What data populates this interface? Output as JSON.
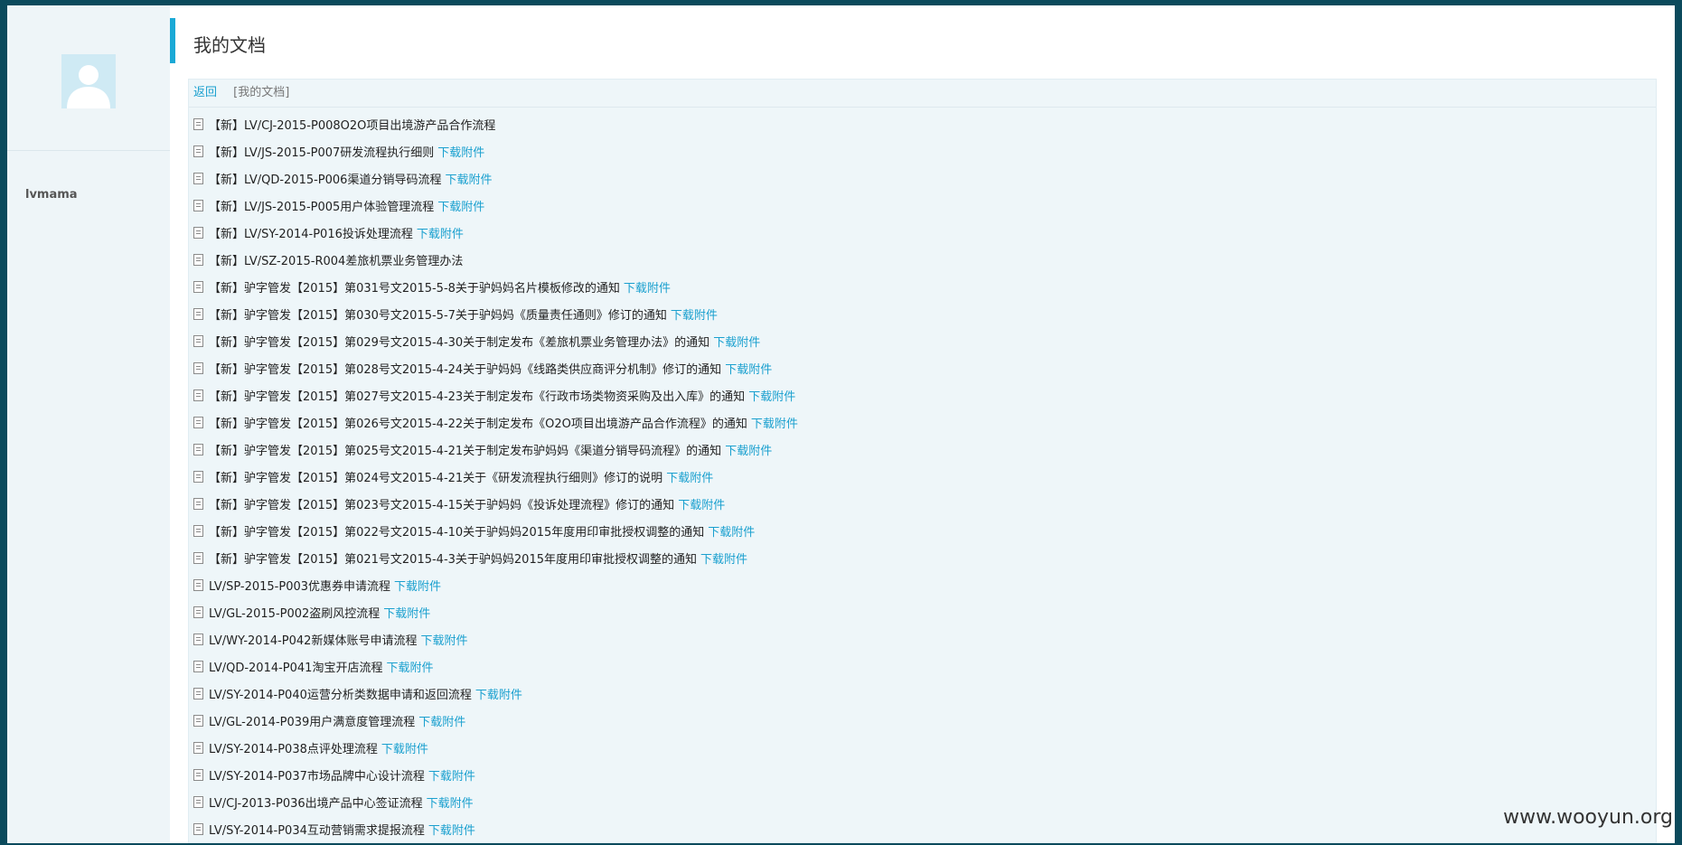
{
  "page": {
    "title": "我的文档",
    "watermark": "www.wooyun.org"
  },
  "sidebar": {
    "username": "lvmama"
  },
  "breadcrumb": {
    "back": "返回",
    "current": "[我的文档]"
  },
  "documents": [
    {
      "title": "【新】LV/CJ-2015-P008O2O项目出境游产品合作流程",
      "link": ""
    },
    {
      "title": "【新】LV/JS-2015-P007研发流程执行细则",
      "link": "下载附件"
    },
    {
      "title": "【新】LV/QD-2015-P006渠道分销导码流程",
      "link": "下载附件"
    },
    {
      "title": "【新】LV/JS-2015-P005用户体验管理流程",
      "link": "下载附件"
    },
    {
      "title": "【新】LV/SY-2014-P016投诉处理流程",
      "link": "下载附件"
    },
    {
      "title": "【新】LV/SZ-2015-R004差旅机票业务管理办法",
      "link": ""
    },
    {
      "title": "【新】驴字管发【2015】第031号文2015-5-8关于驴妈妈名片模板修改的通知",
      "link": "下载附件"
    },
    {
      "title": "【新】驴字管发【2015】第030号文2015-5-7关于驴妈妈《质量责任通则》修订的通知",
      "link": "下载附件"
    },
    {
      "title": "【新】驴字管发【2015】第029号文2015-4-30关于制定发布《差旅机票业务管理办法》的通知",
      "link": "下载附件"
    },
    {
      "title": "【新】驴字管发【2015】第028号文2015-4-24关于驴妈妈《线路类供应商评分机制》修订的通知",
      "link": "下载附件"
    },
    {
      "title": "【新】驴字管发【2015】第027号文2015-4-23关于制定发布《行政市场类物资采购及出入库》的通知",
      "link": "下载附件"
    },
    {
      "title": "【新】驴字管发【2015】第026号文2015-4-22关于制定发布《O2O项目出境游产品合作流程》的通知",
      "link": "下载附件"
    },
    {
      "title": "【新】驴字管发【2015】第025号文2015-4-21关于制定发布驴妈妈《渠道分销导码流程》的通知",
      "link": "下载附件"
    },
    {
      "title": "【新】驴字管发【2015】第024号文2015-4-21关于《研发流程执行细则》修订的说明",
      "link": "下载附件"
    },
    {
      "title": "【新】驴字管发【2015】第023号文2015-4-15关于驴妈妈《投诉处理流程》修订的通知",
      "link": "下载附件"
    },
    {
      "title": "【新】驴字管发【2015】第022号文2015-4-10关于驴妈妈2015年度用印审批授权调整的通知",
      "link": "下载附件"
    },
    {
      "title": "【新】驴字管发【2015】第021号文2015-4-3关于驴妈妈2015年度用印审批授权调整的通知",
      "link": "下载附件"
    },
    {
      "title": "LV/SP-2015-P003优惠券申请流程",
      "link": "下载附件"
    },
    {
      "title": "LV/GL-2015-P002盗刷风控流程",
      "link": "下载附件"
    },
    {
      "title": "LV/WY-2014-P042新媒体账号申请流程",
      "link": "下载附件"
    },
    {
      "title": "LV/QD-2014-P041淘宝开店流程",
      "link": "下载附件"
    },
    {
      "title": "LV/SY-2014-P040运营分析类数据申请和返回流程",
      "link": "下载附件"
    },
    {
      "title": "LV/GL-2014-P039用户满意度管理流程",
      "link": "下载附件"
    },
    {
      "title": "LV/SY-2014-P038点评处理流程",
      "link": "下载附件"
    },
    {
      "title": "LV/SY-2014-P037市场品牌中心设计流程",
      "link": "下载附件"
    },
    {
      "title": "LV/CJ-2013-P036出境产品中心签证流程",
      "link": "下载附件"
    },
    {
      "title": "LV/SY-2014-P034互动营销需求提报流程",
      "link": "下载附件"
    }
  ]
}
